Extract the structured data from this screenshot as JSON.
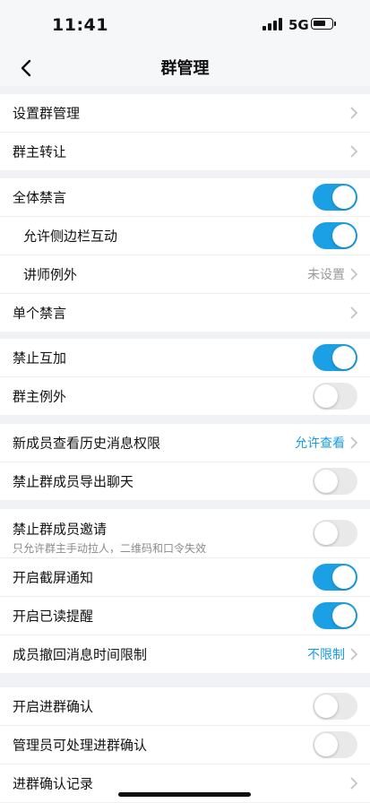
{
  "status_bar": {
    "time": "11:41",
    "network": "5G"
  },
  "nav": {
    "title": "群管理"
  },
  "groups": [
    {
      "rows": [
        {
          "label": "设置群管理",
          "type": "link"
        },
        {
          "label": "群主转让",
          "type": "link"
        }
      ]
    },
    {
      "rows": [
        {
          "label": "全体禁言",
          "type": "toggle",
          "on": true
        },
        {
          "label": "允许侧边栏互动",
          "type": "toggle",
          "on": true
        },
        {
          "label": "讲师例外",
          "type": "value",
          "value": "未设置"
        },
        {
          "label": "单个禁言",
          "type": "link"
        }
      ]
    },
    {
      "rows": [
        {
          "label": "禁止互加",
          "type": "toggle",
          "on": true
        },
        {
          "label": "群主例外",
          "type": "toggle",
          "on": false
        }
      ]
    },
    {
      "rows": [
        {
          "label": "新成员查看历史消息权限",
          "type": "value",
          "value": "允许查看"
        },
        {
          "label": "禁止群成员导出聊天",
          "type": "toggle",
          "on": false
        }
      ]
    },
    {
      "rows": [
        {
          "label": "禁止群成员邀请",
          "subtitle": "只允许群主手动拉人，二维码和口令失效",
          "type": "toggle",
          "on": false
        },
        {
          "label": "开启截屏通知",
          "type": "toggle",
          "on": true
        },
        {
          "label": "开启已读提醒",
          "type": "toggle",
          "on": true
        },
        {
          "label": "成员撤回消息时间限制",
          "type": "value",
          "value": "不限制"
        }
      ]
    },
    {
      "rows": [
        {
          "label": "开启进群确认",
          "type": "toggle",
          "on": false
        },
        {
          "label": "管理员可处理进群确认",
          "type": "toggle",
          "on": false
        },
        {
          "label": "进群确认记录",
          "type": "link"
        }
      ]
    }
  ]
}
